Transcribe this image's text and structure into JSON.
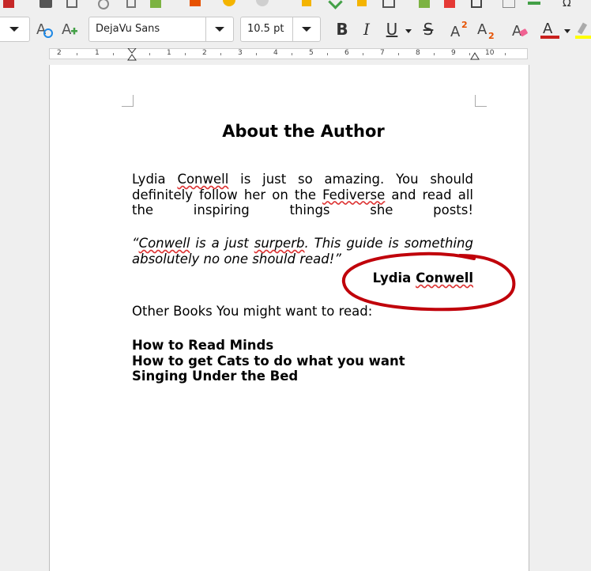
{
  "toolbar": {
    "font_name": "DejaVu Sans",
    "font_size": "10.5 pt",
    "buttons": [
      "bold",
      "italic",
      "underline",
      "strikethrough",
      "superscript",
      "subscript",
      "clear-formatting",
      "font-color",
      "highlight"
    ]
  },
  "ruler": {
    "labels": [
      "2",
      "1",
      "1",
      "2",
      "3",
      "4",
      "5",
      "6",
      "7",
      "8",
      "9",
      "10"
    ]
  },
  "document": {
    "title": "About the Author",
    "bio": {
      "p1": "Lydia ",
      "w1": "Conwell",
      "p2": " is just so amazing. You should definitely follow her on the ",
      "w2": "Fediverse",
      "p3": " and read all the inspiring things she posts!"
    },
    "quote": {
      "p1": "“",
      "w1": "Conwell",
      "p2": " is a just ",
      "w2": "surperb",
      "p3": ". This guide is something absolutely no one should read!”"
    },
    "signature": {
      "first": "Lydia ",
      "last": "Conwell"
    },
    "other_books_heading": "Other Books You might want to read:",
    "books": [
      "How to Read Minds",
      "How to get Cats to do what you want",
      "Singing Under the Bed"
    ]
  },
  "colors": {
    "annotation_circle": "#c0000a",
    "spellcheck": "#dd3333",
    "font_color_bar": "#c9211e",
    "highlight_bar": "#ffff00"
  }
}
